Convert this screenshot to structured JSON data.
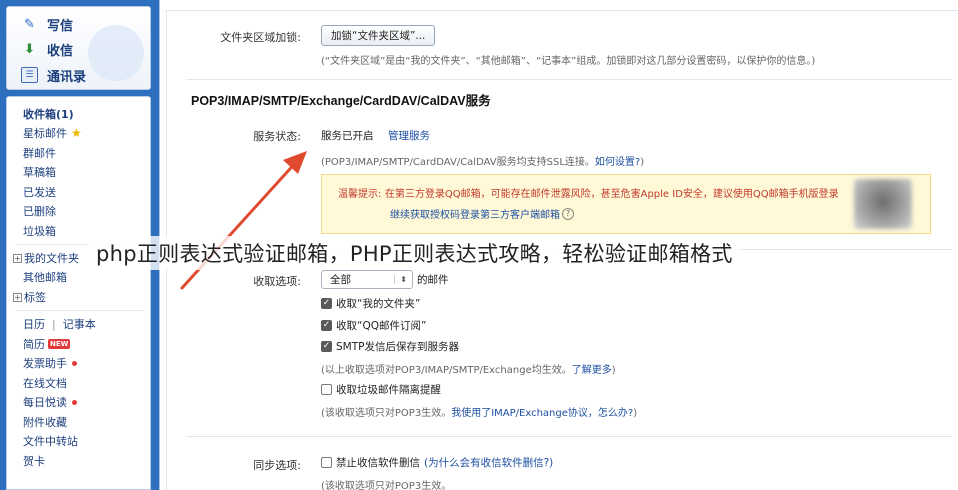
{
  "quick": {
    "write": "写信",
    "inbox": "收信",
    "contacts": "通讯录"
  },
  "nav": {
    "inbox": "收件箱(1)",
    "starred": "星标邮件",
    "groups": "群邮件",
    "drafts": "草稿箱",
    "sent": "已发送",
    "deleted": "已删除",
    "spam": "垃圾箱",
    "my_folders": "我的文件夹",
    "other_mailboxes": "其他邮箱",
    "tags": "标签",
    "calendar": "日历",
    "notes": "记事本",
    "resume": "简历",
    "new_badge": "NEW",
    "invoice": "发票助手",
    "docs": "在线文档",
    "daily_reading": "每日悦读",
    "attachments": "附件收藏",
    "file_transfer": "文件中转站",
    "cards": "贺卡",
    "separator": "|"
  },
  "settings": {
    "folder_lock_label": "文件夹区域加锁:",
    "folder_lock_button": "加锁“文件夹区域”...",
    "folder_lock_note": "(“文件夹区域”是由“我的文件夹”、“其他邮箱”、“记事本”组成。加锁即对这几部分设置密码，以保护你的信息。)",
    "section_title": "POP3/IMAP/SMTP/Exchange/CardDAV/CalDAV服务",
    "service_status_label": "服务状态:",
    "service_status_value": "服务已开启",
    "manage_service_link": "管理服务",
    "ssl_note": "(POP3/IMAP/SMTP/CardDAV/CalDAV服务均支持SSL连接。",
    "ssl_link": "如何设置?",
    "ssl_note_end": ")",
    "warning_prefix": "温馨提示:",
    "warning_text": "在第三方登录QQ邮箱，可能存在邮件泄露风险，甚至危害Apple ID安全，建议使用QQ邮箱手机版登录",
    "warning_link": "继续获取授权码登录第三方客户端邮箱",
    "help_glyph": "?",
    "receive_label": "收取选项:",
    "receive_select": "全部",
    "select_caret": "⬍",
    "receive_suffix": "的邮件",
    "cb_my_folders": "收取“我的文件夹”",
    "cb_qq_subscription": "收取“QQ邮件订阅”",
    "cb_smtp_save": "SMTP发信后保存到服务器",
    "options_note": "(以上收取选项对POP3/IMAP/SMTP/Exchange均生效。",
    "options_link": "了解更多",
    "options_note_end": ")",
    "cb_spam_isolate": "收取垃圾邮件隔离提醒",
    "pop3_note": "(该收取选项只对POP3生效。",
    "pop3_link": "我使用了IMAP/Exchange协议，怎么办?",
    "pop3_note_end": ")",
    "sync_label": "同步选项:",
    "cb_block_delete": "禁止收信软件删信",
    "sync_link": "(为什么会有收信软件删信?)",
    "sync_note": "(该收取选项只对POP3生效。"
  },
  "overlay": {
    "caption": "php正则表达式验证邮箱，PHP正则表达式攻略，轻松验证邮箱格式"
  },
  "colors": {
    "frame_blue": "#2f6fbf",
    "link_blue": "#1e50a2",
    "warning_red": "#c0392b",
    "arrow_red": "#e04a2f",
    "warning_bg": "#fff9d8"
  }
}
